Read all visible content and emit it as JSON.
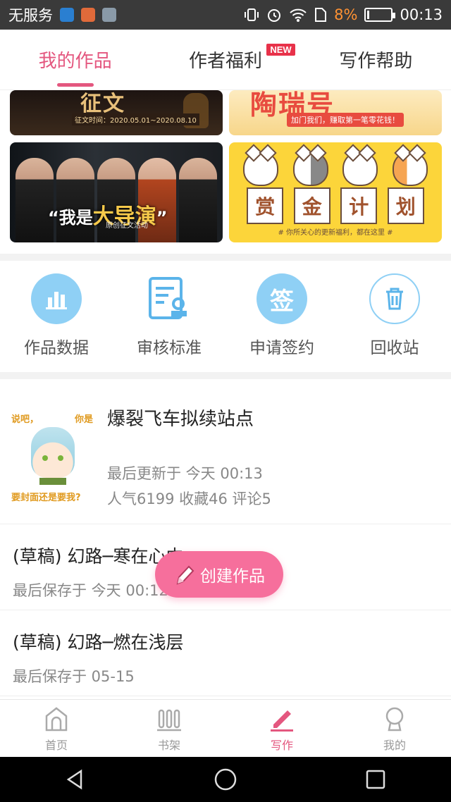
{
  "status_bar": {
    "carrier": "无服务",
    "battery_percent": "8%",
    "time": "00:13"
  },
  "tabs": [
    {
      "label": "我的作品",
      "active": true
    },
    {
      "label": "作者福利",
      "badge": "NEW"
    },
    {
      "label": "写作帮助"
    }
  ],
  "banners": {
    "b1_subtitle": "征文时间：2020.05.01~2020.08.10",
    "b2_title": "陶瑞号",
    "b2_subtitle": "加门我们，赚取第一笔零花钱！",
    "b3_slogan_prefix": "“我是",
    "b3_slogan_big": "大导演",
    "b3_slogan_suffix": "”",
    "b3_subtitle": "原创征文活动",
    "b4_cards": [
      "赏",
      "金",
      "计",
      "划"
    ],
    "b4_subtitle": "# 你所关心的更新福利，都在这里 #"
  },
  "actions": [
    {
      "label": "作品数据",
      "icon": "bar-chart-icon"
    },
    {
      "label": "审核标准",
      "icon": "document-review-icon"
    },
    {
      "label": "申请签约",
      "icon": "sign-icon",
      "glyph": "签"
    },
    {
      "label": "回收站",
      "icon": "trash-icon"
    }
  ],
  "works": {
    "main": {
      "cover_text_left": "说吧，",
      "cover_text_right": "你是",
      "cover_text_bottom": "要封面还是要我?",
      "title": "爆裂飞车拟续站点",
      "updated": "最后更新于 今天 00:13",
      "stats": "人气6199 收藏46 评论5"
    },
    "drafts": [
      {
        "title": "(草稿) 幻路─寒在心中",
        "saved": "最后保存于 今天 00:12"
      },
      {
        "title": "(草稿) 幻路─燃在浅层",
        "saved": "最后保存于 05-15"
      }
    ]
  },
  "fab": {
    "label": "创建作品"
  },
  "bottom_nav": [
    {
      "label": "首页",
      "icon": "home-icon"
    },
    {
      "label": "书架",
      "icon": "bookshelf-icon"
    },
    {
      "label": "写作",
      "icon": "pencil-icon",
      "active": true
    },
    {
      "label": "我的",
      "icon": "profile-icon"
    }
  ],
  "colors": {
    "accent": "#e4577f",
    "fab": "#f66f9c",
    "icon_blue": "#5bb4ea"
  }
}
